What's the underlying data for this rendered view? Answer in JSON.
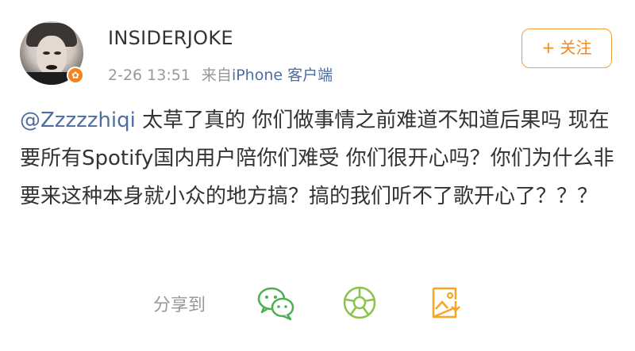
{
  "post": {
    "username": "INSIDERJOKE",
    "time": "2-26 13:51",
    "source_prefix": "来自",
    "source": "iPhone 客户端",
    "badge_icon": "orange-verified-badge",
    "follow_label": "+ 关注",
    "mention": "@Zzzzzhiqi",
    "body": " 太草了真的 你们做事情之前难道不知道后果吗 现在要所有Spotify国内用户陪你们难受 你们很开心吗？你们为什么非要来这种本身就小众的地方搞？搞的我们听不了歌开心了？？？"
  },
  "share": {
    "label": "分享到",
    "targets": [
      {
        "name": "wechat",
        "icon": "wechat-icon"
      },
      {
        "name": "moments",
        "icon": "moments-icon"
      },
      {
        "name": "save-image",
        "icon": "image-save-icon"
      }
    ]
  },
  "colors": {
    "accent_orange": "#f08a24",
    "link_blue": "#4e6ea0",
    "wechat_green": "#4caf50",
    "moments_green": "#8bc34a",
    "save_orange": "#f5a623"
  }
}
